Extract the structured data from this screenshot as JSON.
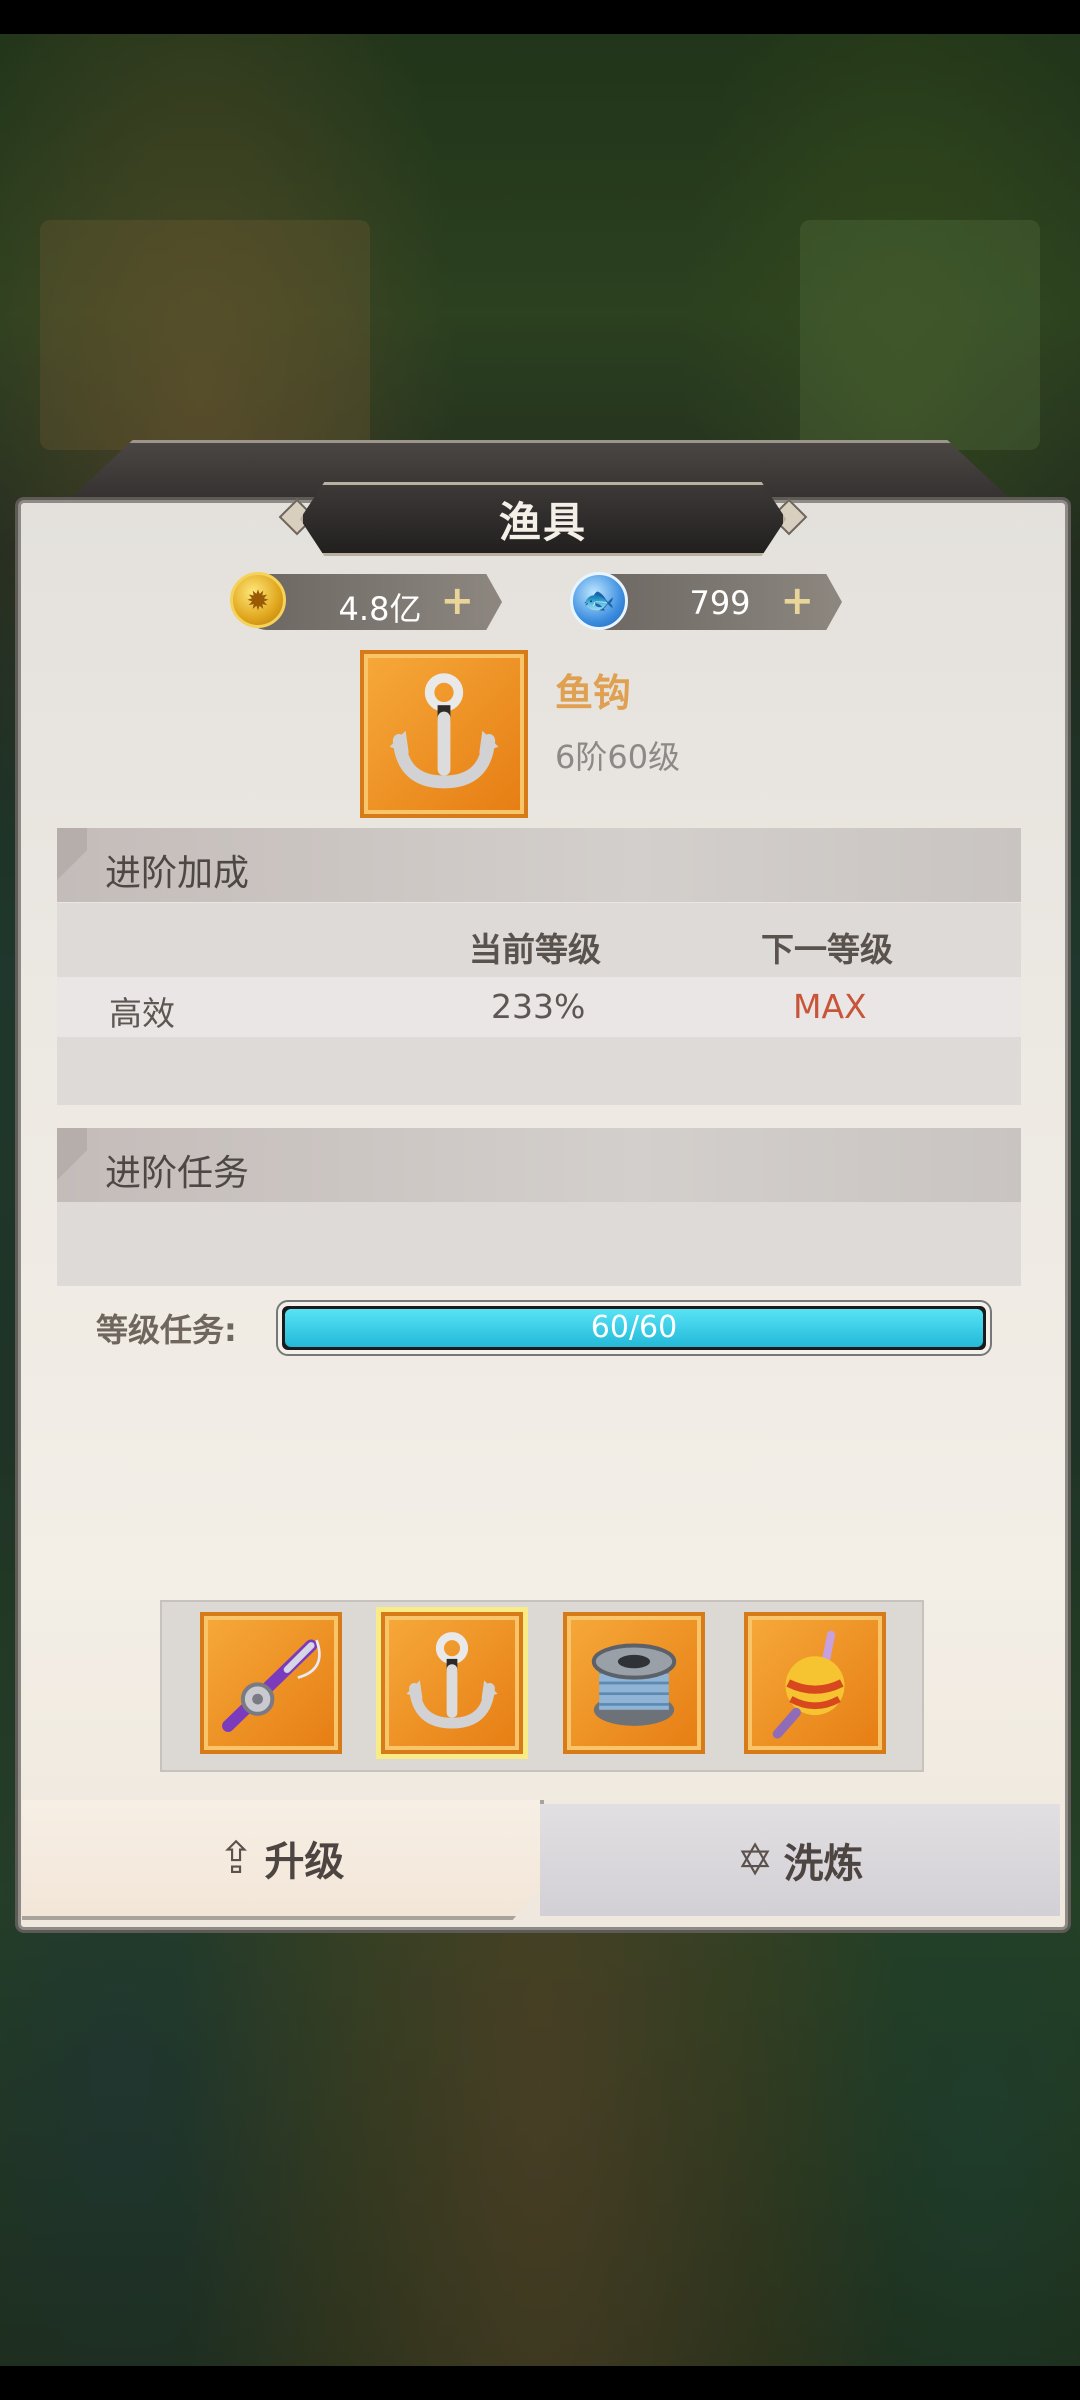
{
  "window": {
    "title": "渔具"
  },
  "currency": {
    "gold": {
      "value": "4.8亿",
      "icon": "coin-icon",
      "plus": "+"
    },
    "pearl": {
      "value": "799",
      "icon": "fish-gem-icon",
      "plus": "+"
    }
  },
  "item": {
    "name": "鱼钩",
    "level": "6阶60级",
    "icon": "fish-hook-icon"
  },
  "advance_bonus": {
    "title": "进阶加成",
    "columns": [
      "当前等级",
      "下一等级"
    ],
    "rows": [
      {
        "label": "高效",
        "current": "233%",
        "next": "MAX"
      }
    ]
  },
  "advance_task": {
    "title": "进阶任务",
    "label": "等级任务:",
    "progress_text": "60/60",
    "progress_fraction": 1.0
  },
  "equipment_slots": [
    {
      "icon": "fishing-rod-icon",
      "selected": false
    },
    {
      "icon": "fish-hook-icon",
      "selected": true
    },
    {
      "icon": "fishing-reel-icon",
      "selected": false
    },
    {
      "icon": "float-bobber-icon",
      "selected": false
    }
  ],
  "tabs": {
    "upgrade": {
      "label": "升级",
      "icon": "upgrade-arrow-icon",
      "active": true
    },
    "refine": {
      "label": "洗炼",
      "icon": "refine-star-icon",
      "active": false
    }
  },
  "colors": {
    "accent_orange": "#e0a052",
    "max_red": "#c8553a",
    "progress_cyan": "#23b9d8",
    "slot_orange": "#f6a93a"
  }
}
